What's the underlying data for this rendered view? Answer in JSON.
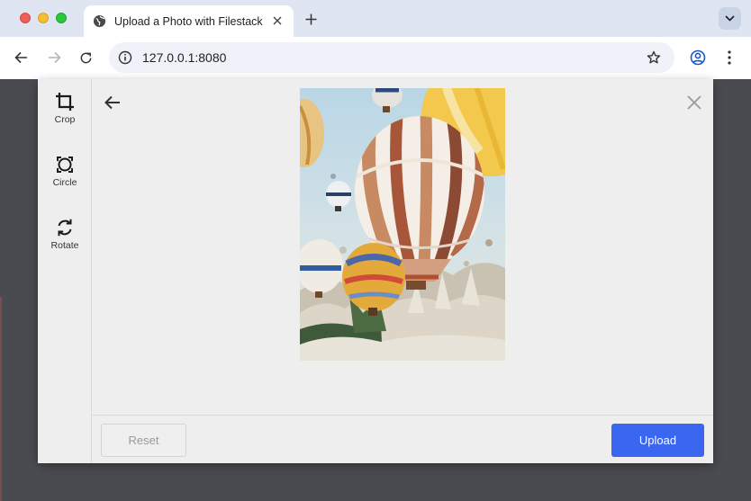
{
  "browser": {
    "tab_title": "Upload a Photo with Filestack",
    "url": "127.0.0.1:8080",
    "colors": {
      "chrome": "#dfe5f1",
      "close": "#ee5f57",
      "minimize": "#f5bd2f",
      "maximize": "#29c840"
    }
  },
  "editor": {
    "tools": [
      {
        "label": "Crop",
        "icon": "crop-icon"
      },
      {
        "label": "Circle",
        "icon": "circle-crop-icon"
      },
      {
        "label": "Rotate",
        "icon": "rotate-icon"
      }
    ],
    "photo": {
      "icon": "hot-air-balloons-photo"
    },
    "reset_label": "Reset",
    "upload_label": "Upload",
    "colors": {
      "accent": "#3b66f0",
      "panel": "#eeeeee"
    }
  }
}
